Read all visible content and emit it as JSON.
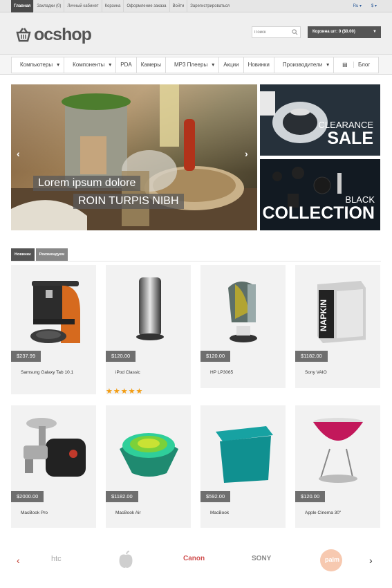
{
  "topbar": {
    "links": [
      "Главная",
      "Закладки (0)",
      "Личный кабинет",
      "Корзина",
      "Оформление заказа",
      "Войти",
      "Зарегистрироваться"
    ],
    "language": "Ru",
    "currency": "$"
  },
  "header": {
    "logo_text": "ocshop",
    "search_placeholder": "Поиск",
    "cart_label": "Корзина шт: 0 ($0.00)"
  },
  "menu": {
    "items": [
      "Компьютеры",
      "Компоненты",
      "PDA",
      "Камеры",
      "MP3 Плееры",
      "Акции",
      "Новинки",
      "Производители",
      "Блог"
    ]
  },
  "slider": {
    "caption_line1": "Lorem ipsum dolore",
    "caption_line2": "ROIN TURPIS NIBH",
    "prev_arrow": "‹",
    "next_arrow": "›"
  },
  "banners": [
    {
      "line1": "CLEARANCE",
      "line2": "SALE"
    },
    {
      "line1": "BLACK",
      "line2": "COLLECTION"
    }
  ],
  "tabs": [
    "Новинки",
    "Рекомендуем"
  ],
  "products": [
    {
      "price": "$237.99",
      "name": "Samsung Galaxy Tab 10.1"
    },
    {
      "price": "$120.00",
      "name": "iPod Classic",
      "rating": 5
    },
    {
      "price": "$120.00",
      "name": "HP LP3065"
    },
    {
      "price": "$1182.00",
      "name": "Sony VAIO"
    },
    {
      "price": "$2000.00",
      "name": "MacBook Pro"
    },
    {
      "price": "$1182.00",
      "name": "MacBook Air"
    },
    {
      "price": "$592.00",
      "name": "MacBook"
    },
    {
      "price": "$120.00",
      "name": "Apple Cinema 30\""
    }
  ],
  "stars": "★★★★★",
  "brands": {
    "items": [
      "htc",
      "Canon",
      "SONY",
      "palm"
    ],
    "prev_arrow": "‹",
    "next_arrow": "›"
  },
  "product_images": [
    "coffee-machine",
    "cylinder-thermos",
    "espresso-machine",
    "napkin-holder",
    "meat-grinder",
    "nested-bowls",
    "storage-container",
    "pink-scale"
  ]
}
